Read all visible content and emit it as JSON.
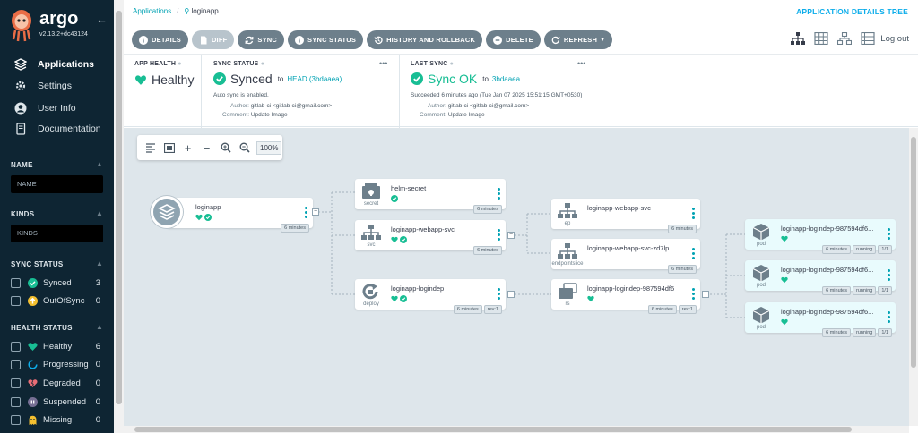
{
  "sidebar": {
    "brand": "argo",
    "version": "v2.13.2+dc43124",
    "nav": [
      {
        "label": "Applications",
        "icon": "layers-icon",
        "active": true
      },
      {
        "label": "Settings",
        "icon": "gears-icon",
        "active": false
      },
      {
        "label": "User Info",
        "icon": "user-icon",
        "active": false
      },
      {
        "label": "Documentation",
        "icon": "book-icon",
        "active": false
      }
    ],
    "name_section": {
      "title": "NAME",
      "placeholder": "NAME"
    },
    "kinds_section": {
      "title": "KINDS",
      "placeholder": "KINDS"
    },
    "sync_status": {
      "title": "SYNC STATUS",
      "items": [
        {
          "label": "Synced",
          "count": "3",
          "icon": "check-circle-icon",
          "color": "#18be94"
        },
        {
          "label": "OutOfSync",
          "count": "0",
          "icon": "arrow-circle-up-icon",
          "color": "#f4c030"
        }
      ]
    },
    "health_status": {
      "title": "HEALTH STATUS",
      "items": [
        {
          "label": "Healthy",
          "count": "6",
          "icon": "heart-icon",
          "color": "#18be94"
        },
        {
          "label": "Progressing",
          "count": "0",
          "icon": "spinner-icon",
          "color": "#0dadea"
        },
        {
          "label": "Degraded",
          "count": "0",
          "icon": "broken-heart-icon",
          "color": "#e96d76"
        },
        {
          "label": "Suspended",
          "count": "0",
          "icon": "pause-circle-icon",
          "color": "#766f94"
        },
        {
          "label": "Missing",
          "count": "0",
          "icon": "ghost-icon",
          "color": "#f4c030"
        }
      ]
    }
  },
  "header": {
    "breadcrumb_root": "Applications",
    "breadcrumb_current": "loginapp",
    "title": "APPLICATION DETAILS TREE",
    "logout": "Log out"
  },
  "toolbar": {
    "details": "DETAILS",
    "diff": "DIFF",
    "sync": "SYNC",
    "sync_status": "SYNC STATUS",
    "history": "HISTORY AND ROLLBACK",
    "delete": "DELETE",
    "refresh": "REFRESH"
  },
  "status": {
    "app_health": {
      "label": "APP HEALTH",
      "value": "Healthy"
    },
    "sync_status": {
      "label": "SYNC STATUS",
      "value": "Synced",
      "to": "to",
      "revision": "HEAD (3bdaaea)",
      "note": "Auto sync is enabled.",
      "author_key": "Author:",
      "author": "gitlab-ci <gitlab-ci@gmail.com> -",
      "comment_key": "Comment:",
      "comment": "Update Image"
    },
    "last_sync": {
      "label": "LAST SYNC",
      "value": "Sync OK",
      "to": "to",
      "revision": "3bdaaea",
      "note": "Succeeded 6 minutes ago (Tue Jan 07 2025 15:51:15 GMT+0530)",
      "author_key": "Author:",
      "author": "gitlab-ci <gitlab-ci@gmail.com> -",
      "comment_key": "Comment:",
      "comment": "Update Image"
    },
    "more": "•••"
  },
  "graph": {
    "zoom": "100%",
    "app": {
      "name": "loginapp",
      "age": "6 minutes"
    },
    "nodes": [
      {
        "name": "helm-secret",
        "type": "secret",
        "icon": "secret-icon",
        "tags": [
          "6 minutes"
        ]
      },
      {
        "name": "loginapp-webapp-svc",
        "type": "svc",
        "icon": "network-icon",
        "tags": [
          "6 minutes"
        ]
      },
      {
        "name": "loginapp-logindep",
        "type": "deploy",
        "icon": "deploy-icon",
        "tags": [
          "6 minutes",
          "rev:1"
        ]
      },
      {
        "name": "loginapp-webapp-svc",
        "type": "ep",
        "icon": "network-icon",
        "tags": [
          "6 minutes"
        ]
      },
      {
        "name": "loginapp-webapp-svc-zd7lp",
        "type": "endpointslice",
        "icon": "network-icon",
        "tags": [
          "6 minutes"
        ]
      },
      {
        "name": "loginapp-logindep-987594df6",
        "type": "rs",
        "icon": "replicaset-icon",
        "tags": [
          "6 minutes",
          "rev:1"
        ]
      },
      {
        "name": "loginapp-logindep-987594df6...",
        "type": "pod",
        "icon": "cube-icon",
        "tags": [
          "6 minutes",
          "running",
          "1/1"
        ]
      },
      {
        "name": "loginapp-logindep-987594df6...",
        "type": "pod",
        "icon": "cube-icon",
        "tags": [
          "6 minutes",
          "running",
          "1/1"
        ]
      },
      {
        "name": "loginapp-logindep-987594df6...",
        "type": "pod",
        "icon": "cube-icon",
        "tags": [
          "6 minutes",
          "running",
          "1/1"
        ]
      }
    ]
  },
  "colors": {
    "sidebar_bg": "#0e2533",
    "accent": "#00a2b3",
    "healthy": "#18be94",
    "button": "#6d7f8b",
    "title": "#0dadea"
  }
}
